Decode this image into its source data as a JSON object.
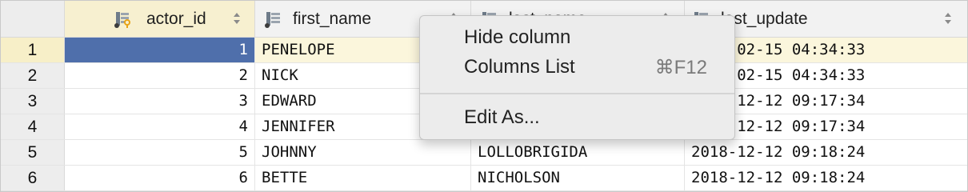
{
  "columns": [
    {
      "name": "actor_id"
    },
    {
      "name": "first_name"
    },
    {
      "name": "last_name"
    },
    {
      "name": "last_update"
    }
  ],
  "rows": [
    {
      "num": "1",
      "actor_id": "1",
      "first_name": "PENELOPE",
      "last_name": "",
      "last_update": "2006-02-15 04:34:33"
    },
    {
      "num": "2",
      "actor_id": "2",
      "first_name": "NICK",
      "last_name": "",
      "last_update": "2006-02-15 04:34:33"
    },
    {
      "num": "3",
      "actor_id": "3",
      "first_name": "EDWARD",
      "last_name": "",
      "last_update": "2018-12-12 09:17:34"
    },
    {
      "num": "4",
      "actor_id": "4",
      "first_name": "JENNIFER",
      "last_name": "",
      "last_update": "2018-12-12 09:17:34"
    },
    {
      "num": "5",
      "actor_id": "5",
      "first_name": "JOHNNY",
      "last_name": "LOLLOBRIGIDA",
      "last_update": "2018-12-12 09:18:24"
    },
    {
      "num": "6",
      "actor_id": "6",
      "first_name": "BETTE",
      "last_name": "NICHOLSON",
      "last_update": "2018-12-12 09:18:24"
    }
  ],
  "selection": {
    "row": "1",
    "column": "actor_id",
    "color": "#4f6fab"
  },
  "context_menu": {
    "items": [
      {
        "label": "Hide column",
        "shortcut": ""
      },
      {
        "label": "Columns List",
        "shortcut": "⌘F12"
      },
      {
        "label": "Edit As...",
        "shortcut": ""
      }
    ]
  },
  "icons": {
    "key_column": "primary-key-column-icon",
    "column": "column-icon",
    "sort": "sort-arrows-icon"
  }
}
